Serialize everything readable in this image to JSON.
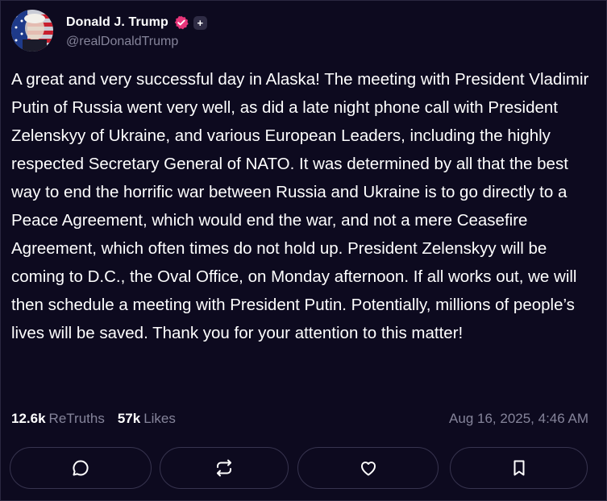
{
  "author": {
    "display_name": "Donald J. Trump",
    "handle": "@realDonaldTrump",
    "plus_badge": "+"
  },
  "post": {
    "text": "A great and very successful day in Alaska! The meeting with President Vladimir Putin of Russia went very well, as did a late night phone call with President Zelenskyy of Ukraine, and various European Leaders, including the highly respected Secretary General of NATO. It was determined by all that the best way to end the horrific war between Russia and Ukraine is to go directly to a Peace Agreement, which would end the war, and not a mere Ceasefire Agreement, which often times do not hold up. President Zelenskyy will be coming to D.C., the Oval Office, on Monday afternoon. If all works out, we will then schedule a meeting with President Putin. Potentially, millions of people’s lives will be saved. Thank you for your attention to this matter!",
    "retruths_count": "12.6k",
    "retruths_label": "ReTruths",
    "likes_count": "57k",
    "likes_label": "Likes",
    "timestamp": "Aug 16, 2025, 4:46 AM"
  },
  "actions": [
    {
      "name": "reply",
      "icon": "comment-icon"
    },
    {
      "name": "retruth",
      "icon": "repost-icon"
    },
    {
      "name": "like",
      "icon": "heart-icon"
    },
    {
      "name": "bookmark",
      "icon": "bookmark-icon"
    }
  ],
  "colors": {
    "background": "#0d0a1f",
    "muted_text": "#85849a",
    "verified_badge": "#e8357a",
    "button_border": "#37344f"
  }
}
